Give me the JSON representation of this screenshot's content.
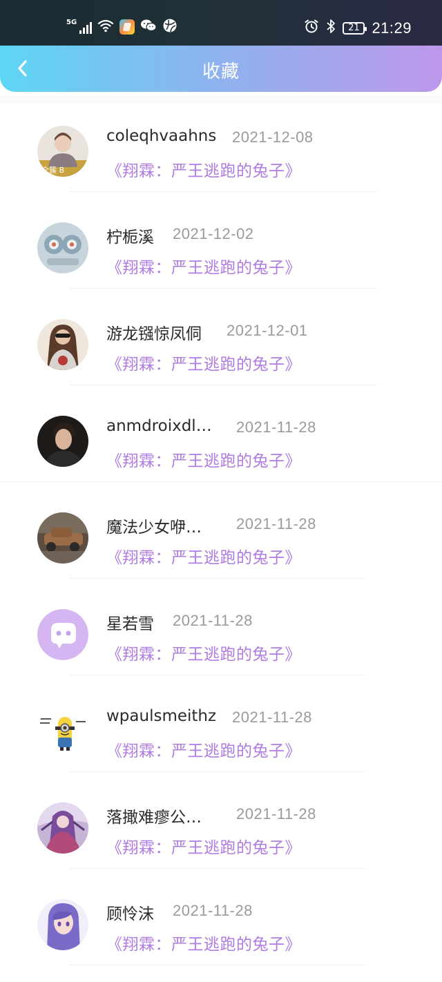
{
  "status_bar": {
    "network": "5G",
    "battery": "21",
    "time": "21:29",
    "icons": [
      "signal-icon",
      "wifi-icon",
      "app-badge-icon",
      "wechat-icon",
      "browser-icon",
      "alarm-icon",
      "bluetooth-icon",
      "battery-icon"
    ]
  },
  "header": {
    "title": "收藏",
    "back_icon": "chevron-left-icon",
    "gradient": [
      "#5ed6f4",
      "#bd98ea"
    ]
  },
  "colors": {
    "book_title": "#b07ce0",
    "date": "#9a9a9a",
    "name": "#2b2b2b"
  },
  "items": [
    {
      "name": "coleqhvaahns",
      "date": "2021-12-08",
      "book": "《翔霖：严王逃跑的兔子》"
    },
    {
      "name": "柠栀溪",
      "date": "2021-12-02",
      "book": "《翔霖：严王逃跑的兔子》"
    },
    {
      "name": "游龙镪惊凤侗",
      "date": "2021-12-01",
      "book": "《翔霖：严王逃跑的兔子》"
    },
    {
      "name": "anmdroixdl…",
      "date": "2021-11-28",
      "book": "《翔霖：严王逃跑的兔子》"
    },
    {
      "name": "魔法少女咿…",
      "date": "2021-11-28",
      "book": "《翔霖：严王逃跑的兔子》"
    },
    {
      "name": "星若雪",
      "date": "2021-11-28",
      "book": "《翔霖：严王逃跑的兔子》"
    },
    {
      "name": "wpaulsmeithz",
      "date": "2021-11-28",
      "book": "《翔霖：严王逃跑的兔子》"
    },
    {
      "name": "落撖难瘳公…",
      "date": "2021-11-28",
      "book": "《翔霖：严王逃跑的兔子》"
    },
    {
      "name": "顾怜沫",
      "date": "2021-11-28",
      "book": "《翔霖：严王逃跑的兔子》"
    }
  ]
}
